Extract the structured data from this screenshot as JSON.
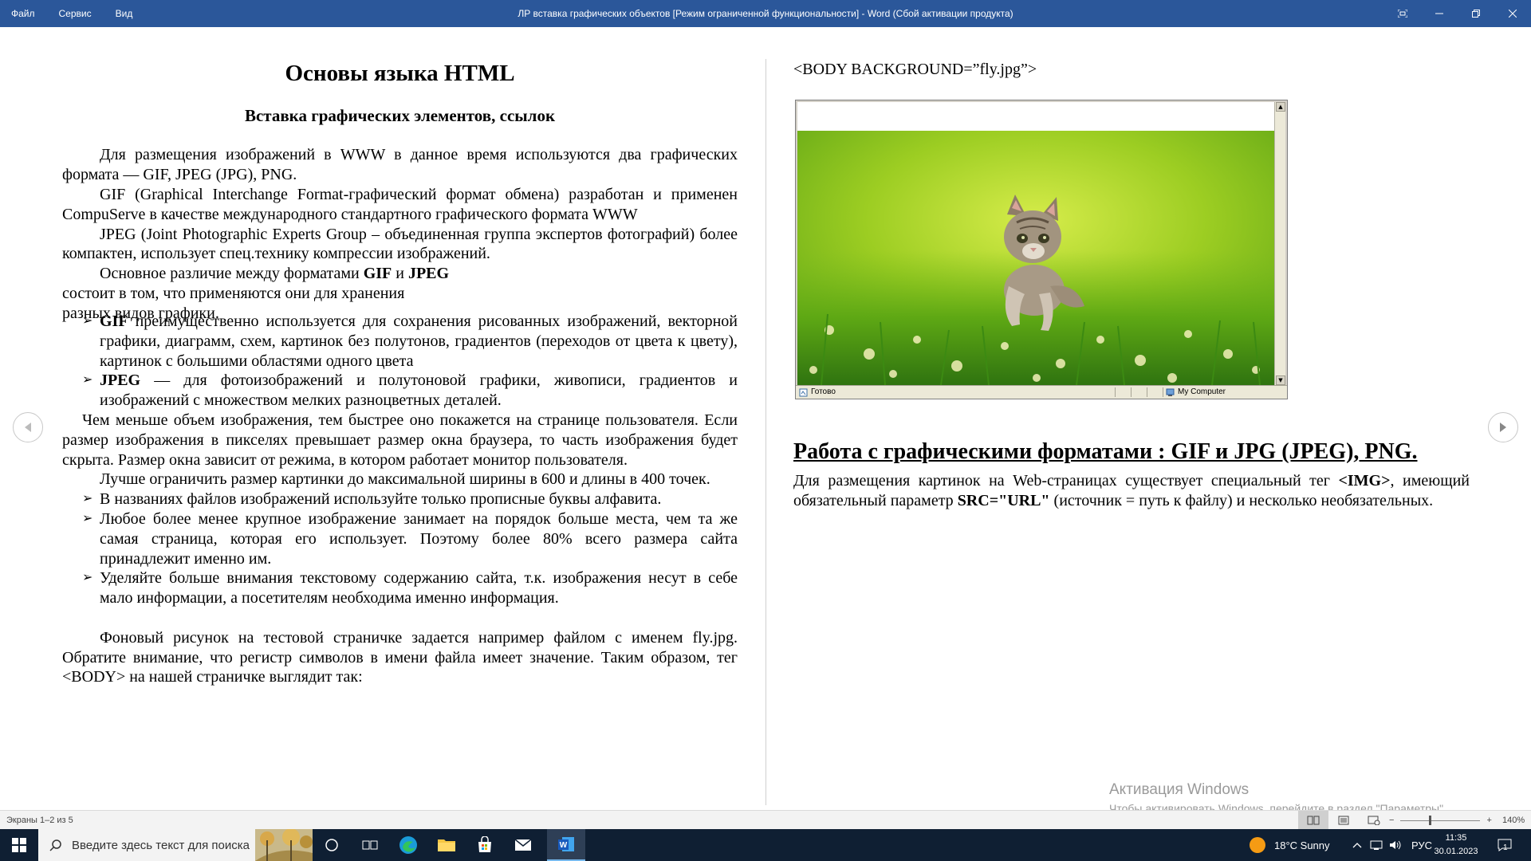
{
  "titlebar": {
    "menu": [
      "Файл",
      "Сервис",
      "Вид"
    ],
    "title": "ЛР вставка графических объектов [Режим ограниченной функциональности] - Word (Сбой активации продукта)"
  },
  "left": {
    "heading": "Основы языка HTML",
    "subheading": "Вставка графических элементов, ссылок",
    "p1": "Для размещения изображений в WWW в данное время используются два графических формата — GIF, JPEG (JPG), PNG.",
    "gif_desc": "GIF (Graphical Interchange Format-графический формат обмена) разработан и применен CompuServe в качестве международного стандартного графического формата WWW",
    "jpeg_desc": "JPEG (Joint Photographic Experts Group – объединенная группа экспертов фотографий) более компактен, использует спец.технику компрессии изображений.",
    "diff_pre": "Основное различие между форматами ",
    "diff_gif": "GIF",
    "diff_and": " и ",
    "diff_jpeg": "JPEG",
    "diff_line2": "состоит в том, что применяются они для хранения",
    "diff_line3": "разных видов графики.",
    "bullet_gif_b": "GIF",
    "bullet_gif": " преимущественно используется для сохранения рисованных изображений, векторной графики, диаграмм, схем, картинок без полутонов, градиентов (переходов от цвета к цвету), картинок с большими областями одного цвета",
    "bullet_jpeg_b": "JPEG",
    "bullet_jpeg": " — для фотоизображений и полутоновой графики, живописи, градиентов и изображений с множеством мелких разноцветных деталей.",
    "size_p1": "Чем меньше объем изображения, тем быстрее оно покажется на странице пользователя.",
    "size_p2": "Если размер изображения в пикселях превышает размер окна браузера, то часть изображения будет скрыта. Размер окна зависит от режима, в котором работает монитор пользователя.",
    "limit": "Лучше ограничить размер картинки до максимальной ширины в 600 и длины в 400 точек.",
    "tips": [
      "В названиях файлов изображений используйте только прописные буквы алфавита.",
      "Любое более менее крупное изображение занимает на порядок больше места, чем та же самая страница, которая его использует. Поэтому более 80% всего размера сайта принадлежит именно им.",
      "Уделяйте больше внимания текстовому содержанию сайта, т.к. изображения несут в себе мало информации, а посетителям необходима именно информация."
    ],
    "bg_p": "Фоновый рисунок на тестовой страничке задается например файлом с именем fly.jpg. Обратите внимание, что регистр символов в имени файла имеет значение. Таким образом, тег <BODY> на нашей страничке выглядит так:"
  },
  "right": {
    "body_tag": "<BODY BACKGROUND=”fly.jpg”>",
    "browser_status": "Готово",
    "browser_zone": "My Computer",
    "heading": "Работа с графическими  форматами : GIF и JPG (JPEG), PNG.",
    "p_pre": "Для размещения картинок на Web-страницах существует специальный тег ",
    "p_tag": "<IMG>",
    "p_mid": ", имеющий обязательный параметр ",
    "p_src": "SRC=\"URL\"",
    "p_post": " (источник = путь к файлу) и несколько необязательных."
  },
  "activation": {
    "title": "Активация Windows",
    "subtitle": "Чтобы активировать Windows, перейдите в раздел \"Параметры\"."
  },
  "statusbar": {
    "pages": "Экраны 1–2 из 5",
    "zoom": "140%"
  },
  "taskbar": {
    "search_placeholder": "Введите здесь текст для поиска",
    "weather": "18°C  Sunny",
    "lang": "РУС",
    "time": "11:35",
    "date": "30.01.2023",
    "notifications": "1"
  },
  "colors": {
    "word_blue": "#2b579a",
    "taskbar": "#0f1f33",
    "grass": "#7cc21a"
  }
}
